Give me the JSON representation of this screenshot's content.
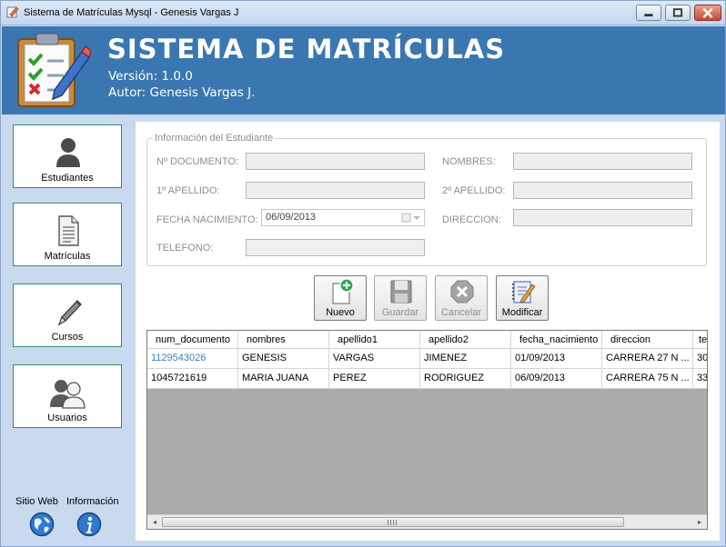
{
  "window": {
    "title": "Sistema de Matrículas Mysql - Genesis Vargas J"
  },
  "header": {
    "title": "SISTEMA DE MATRÍCULAS",
    "version": "Versión: 1.0.0",
    "author": "Autor: Genesis Vargas J."
  },
  "sidebar": {
    "items": [
      {
        "label": "Estudiantes",
        "icon": "person-icon"
      },
      {
        "label": "Matrículas",
        "icon": "document-icon"
      },
      {
        "label": "Cursos",
        "icon": "pencil-icon"
      },
      {
        "label": "Usuarios",
        "icon": "users-icon"
      }
    ],
    "links": [
      {
        "label": "Sitio Web",
        "icon": "globe-icon"
      },
      {
        "label": "Información",
        "icon": "info-icon"
      }
    ]
  },
  "form": {
    "group_title": "Información del Estudiante",
    "labels": {
      "documento": "Nº DOCUMENTO:",
      "nombres": "NOMBRES:",
      "apellido1": "1º APELLIDO:",
      "apellido2": "2º APELLIDO:",
      "fecha": "FECHA NACIMIENTO:",
      "direccion": "DIRECCION:",
      "telefono": "TELEFONO:"
    },
    "fecha_value": "06/09/2013"
  },
  "actions": [
    {
      "label": "Nuevo",
      "icon": "new-document-icon",
      "enabled": true
    },
    {
      "label": "Guardar",
      "icon": "save-icon",
      "enabled": false
    },
    {
      "label": "Cancelar",
      "icon": "cancel-icon",
      "enabled": false
    },
    {
      "label": "Modificar",
      "icon": "edit-notebook-icon",
      "enabled": true
    }
  ],
  "table": {
    "columns": [
      "num_documento",
      "nombres",
      "apellido1",
      "apellido2",
      "fecha_nacimiento",
      "direccion",
      "te"
    ],
    "rows": [
      [
        "1129543026",
        "GENESIS",
        "VARGAS",
        "JIMENEZ",
        "01/09/2013",
        "CARRERA 27 N ...",
        "30"
      ],
      [
        "1045721619",
        "MARIA JUANA",
        "PEREZ",
        "RODRIGUEZ",
        "06/09/2013",
        "CARRERA 75 N ...",
        "33"
      ]
    ],
    "selected_row": 0
  },
  "colors": {
    "header_bg": "#3a77b1",
    "sidebar_bg": "#c9daf0",
    "nav_border": "#3c8d62",
    "selected_text": "#3d7fbf"
  }
}
